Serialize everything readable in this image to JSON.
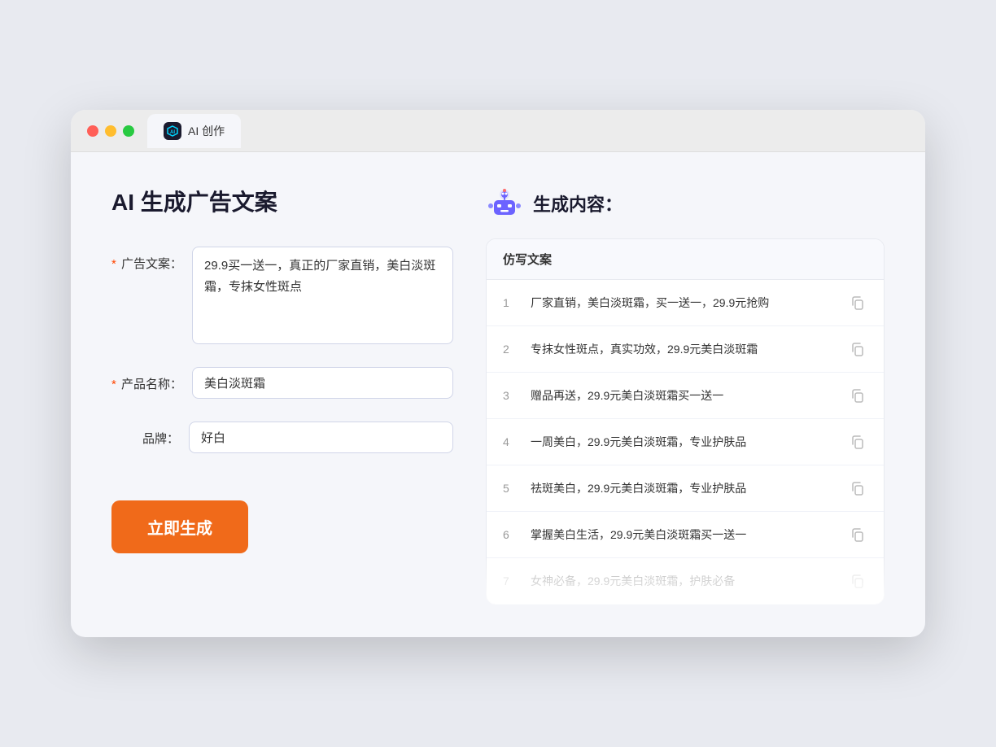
{
  "window": {
    "tab_label": "AI 创作",
    "tab_icon_text": "AI"
  },
  "left": {
    "page_title": "AI 生成广告文案",
    "form": {
      "ad_label": "广告文案：",
      "ad_required": "＊",
      "ad_value": "29.9买一送一，真正的厂家直销，美白淡斑霜，专抹女性斑点",
      "product_label": "产品名称：",
      "product_required": "＊",
      "product_value": "美白淡斑霜",
      "brand_label": "品牌：",
      "brand_value": "好白"
    },
    "button_label": "立即生成"
  },
  "right": {
    "title": "生成内容：",
    "table_header": "仿写文案",
    "results": [
      {
        "num": "1",
        "text": "厂家直销，美白淡斑霜，买一送一，29.9元抢购"
      },
      {
        "num": "2",
        "text": "专抹女性斑点，真实功效，29.9元美白淡斑霜"
      },
      {
        "num": "3",
        "text": "赠品再送，29.9元美白淡斑霜买一送一"
      },
      {
        "num": "4",
        "text": "一周美白，29.9元美白淡斑霜，专业护肤品"
      },
      {
        "num": "5",
        "text": "祛斑美白，29.9元美白淡斑霜，专业护肤品"
      },
      {
        "num": "6",
        "text": "掌握美白生活，29.9元美白淡斑霜买一送一"
      },
      {
        "num": "7",
        "text": "女神必备，29.9元美白淡斑霜，护肤必备"
      }
    ]
  }
}
